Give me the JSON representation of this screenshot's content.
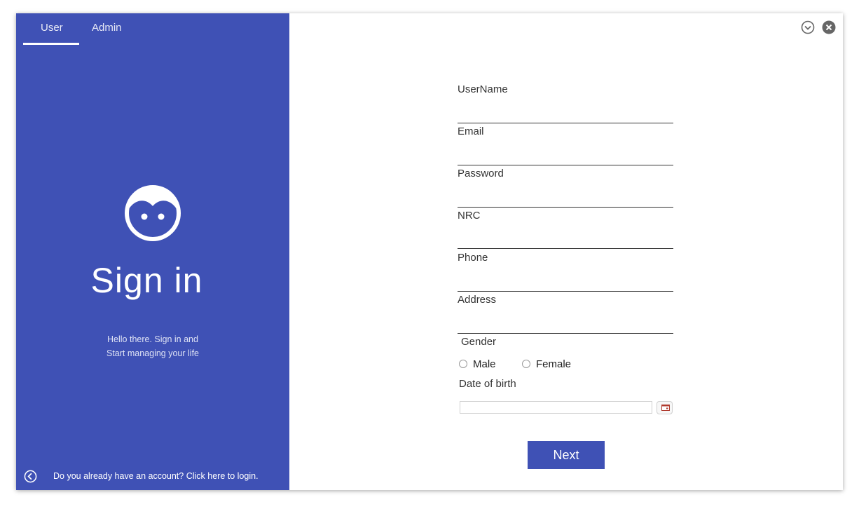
{
  "tabs": [
    {
      "label": "User",
      "active": true
    },
    {
      "label": "Admin",
      "active": false
    }
  ],
  "left_panel": {
    "avatar_icon": "face-icon",
    "heading": "Sign in",
    "tagline_line1": "Hello there. Sign in and",
    "tagline_line2": "Start managing your life",
    "back_icon": "chevron-left-circle-icon",
    "login_link": "Do you already have an account? Click here to login."
  },
  "window_controls": {
    "minimize_icon": "chevron-down-circle-icon",
    "close_icon": "close-circle-icon"
  },
  "form": {
    "fields": [
      {
        "label": "UserName",
        "value": "",
        "placeholder": ""
      },
      {
        "label": "Email",
        "value": "",
        "placeholder": ""
      },
      {
        "label": "Password",
        "value": "",
        "placeholder": ""
      },
      {
        "label": "NRC",
        "value": "",
        "placeholder": ""
      },
      {
        "label": "Phone",
        "value": "",
        "placeholder": ""
      },
      {
        "label": "Address",
        "value": "",
        "placeholder": ""
      }
    ],
    "gender": {
      "label": "Gender",
      "options": [
        "Male",
        "Female"
      ],
      "selected": ""
    },
    "dob": {
      "label": "Date of birth",
      "value": "",
      "calendar_icon": "calendar-icon"
    },
    "next_label": "Next"
  },
  "colors": {
    "accent": "#3f51b5",
    "text": "#333333",
    "background": "#ffffff"
  }
}
